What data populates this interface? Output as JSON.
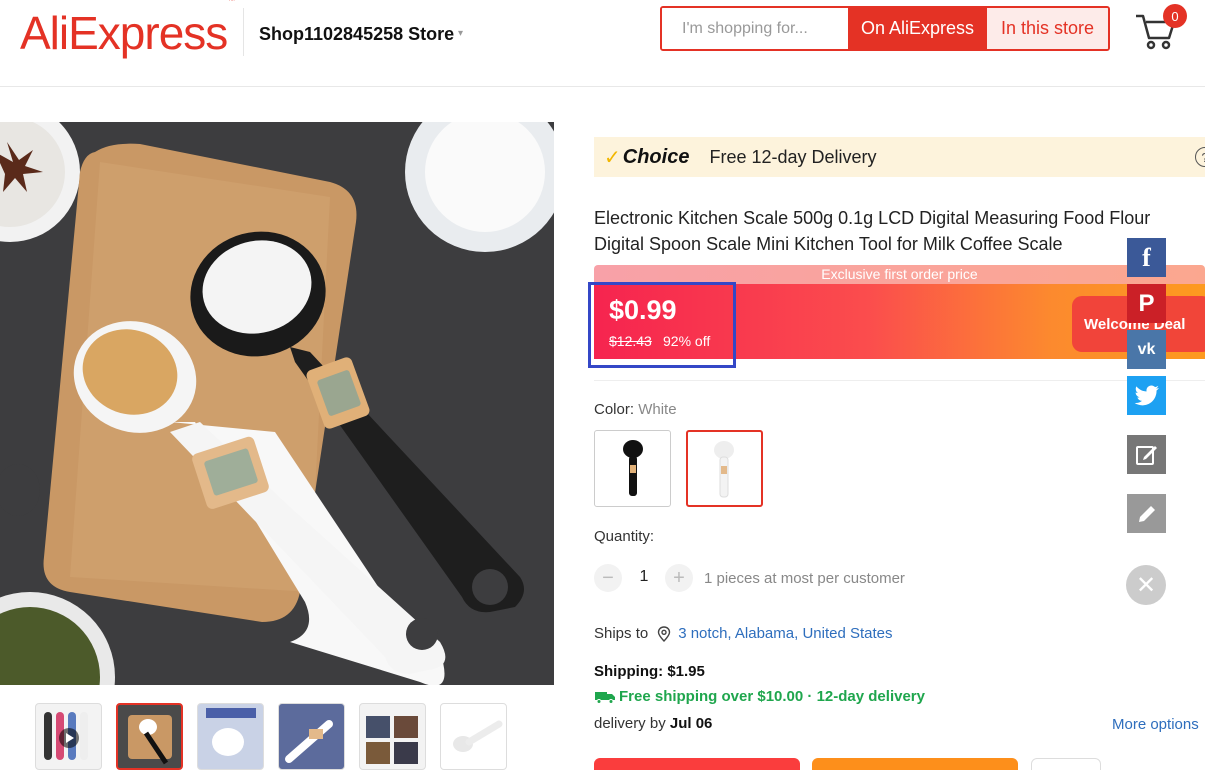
{
  "header": {
    "logo": "AliExpress",
    "logo_tm": "™",
    "store_name": "Shop1102845258 Store",
    "store_caret": "▾",
    "search_placeholder": "I'm shopping for...",
    "btn_on_aliexpress": "On AliExpress",
    "btn_in_store": "In this store",
    "cart_count": "0"
  },
  "choice": {
    "check": "✓",
    "logo": "Choice",
    "text": "Free 12-day Delivery",
    "help": "?"
  },
  "product": {
    "title": "Electronic Kitchen Scale 500g 0.1g LCD Digital Measuring Food Flour Digital Spoon Scale Mini Kitchen Tool for Milk Coffee Scale",
    "exclusive_label": "Exclusive first order price",
    "price": "$0.99",
    "original_price": "$12.43",
    "discount": "92% off",
    "welcome_deal": "Welcome Deal",
    "color_label": "Color: ",
    "color_value": "White",
    "quantity_label": "Quantity:",
    "quantity_value": "1",
    "qty_minus": "−",
    "qty_plus": "+",
    "quantity_note": "1 pieces at most per customer"
  },
  "shipping": {
    "ships_to_label": "Ships to",
    "location": "3 notch, Alabama, United States",
    "cost": "Shipping: $1.95",
    "free_shipping": "Free shipping over $10.00 · 12-day delivery",
    "delivery_prefix": "delivery by ",
    "delivery_date": "Jul 06",
    "more_options": "More options"
  },
  "social": {
    "facebook": "f",
    "pinterest": "P",
    "vk": "vk",
    "close": "✕"
  },
  "colors": {
    "brand_red": "#e43225",
    "price_gradient_start": "#f6244f",
    "price_gradient_end": "#fd9a1f",
    "link_blue": "#2e6ebd",
    "free_green": "#1fa64d"
  }
}
